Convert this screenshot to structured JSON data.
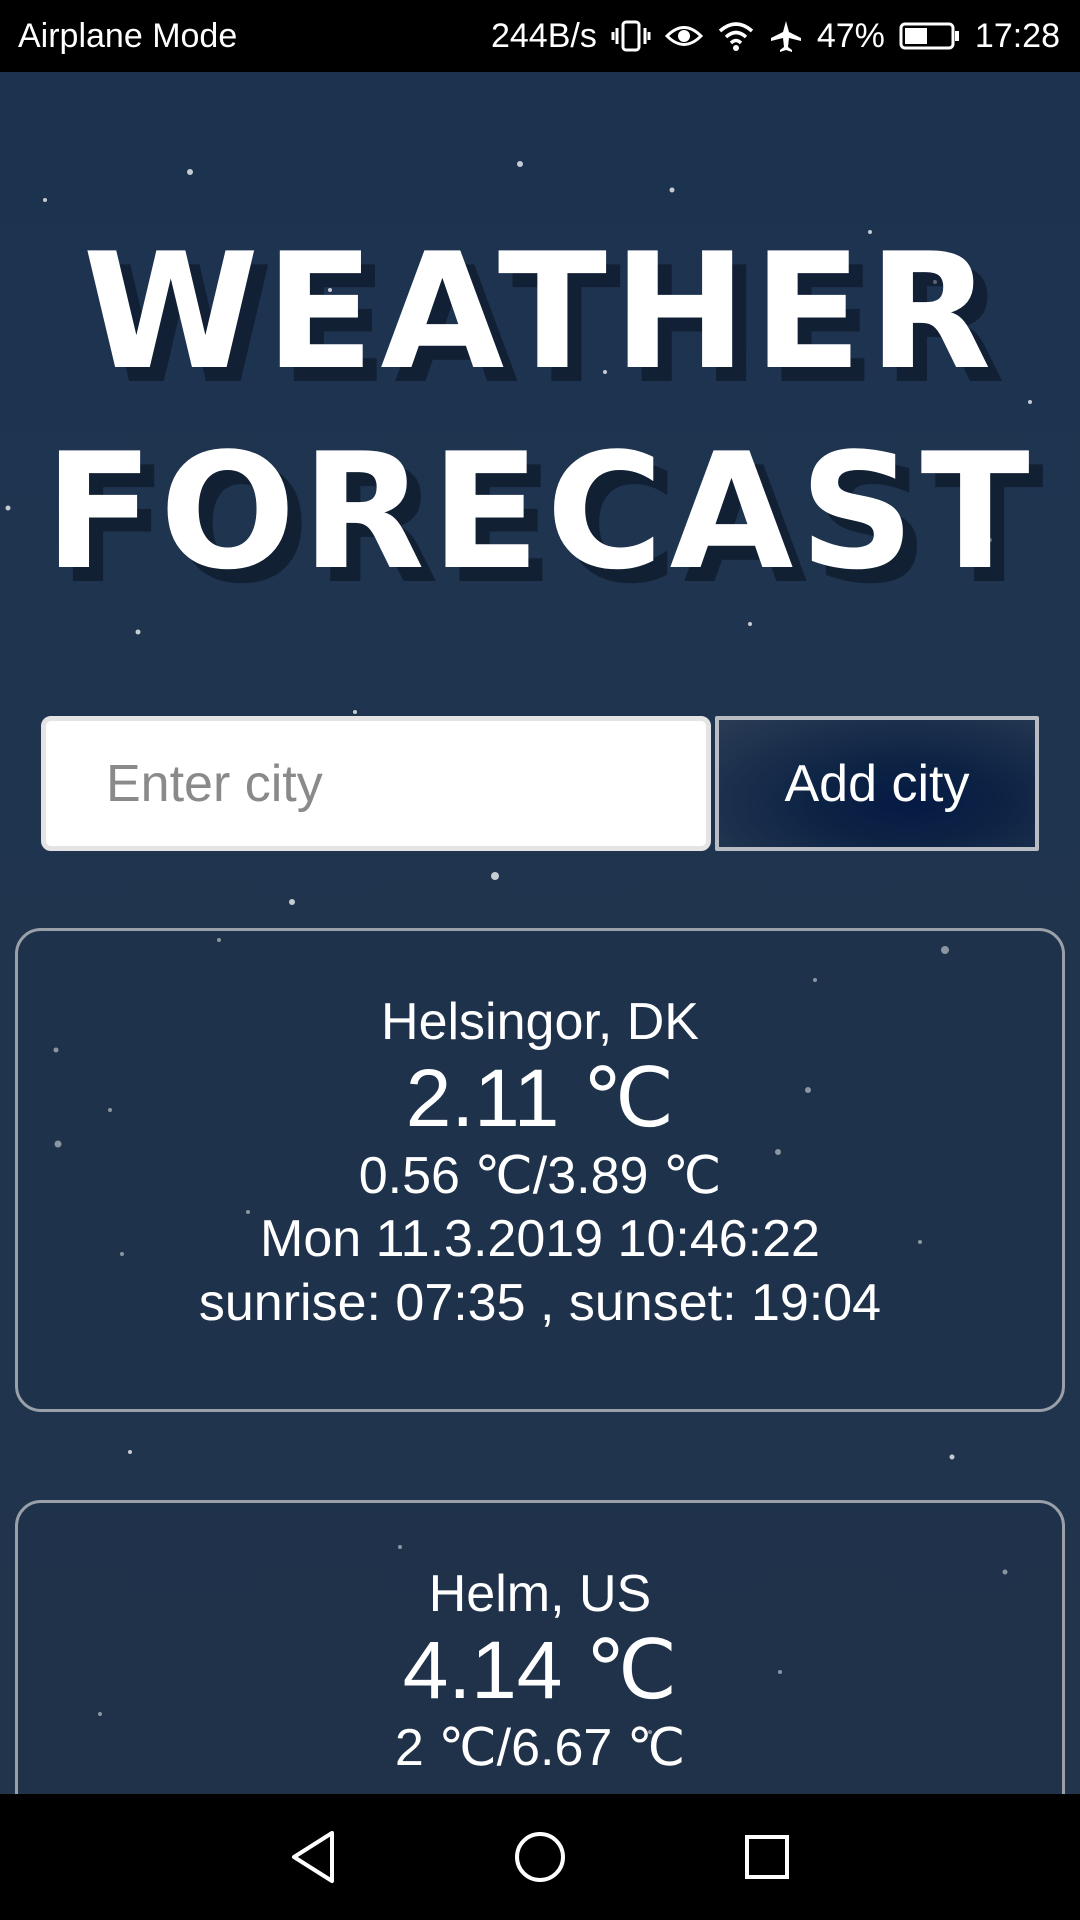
{
  "status_bar": {
    "mode": "Airplane Mode",
    "net_speed": "244B/s",
    "battery": "47%",
    "time": "17:28",
    "icons": [
      "vibrate-icon",
      "eye-icon",
      "wifi-icon",
      "airplane-icon",
      "battery-icon"
    ]
  },
  "app": {
    "title_line1": "WEATHER",
    "title_line2": "FORECAST",
    "input_placeholder": "Enter city",
    "add_button": "Add city"
  },
  "cards": [
    {
      "city": "Helsingor, DK",
      "temp": "2.11 ℃",
      "range": "0.56 ℃/3.89 ℃",
      "date": "Mon 11.3.2019 10:46:22",
      "sun": "sunrise: 07:35 , sunset: 19:04"
    },
    {
      "city": "Helm, US",
      "temp": "4.14 ℃",
      "range": "2 ℃/6.67 ℃"
    }
  ],
  "nav_bar": {
    "icons": [
      "back-icon",
      "home-icon",
      "recents-icon"
    ]
  },
  "colors": {
    "background": "#1e334e",
    "card_border": "#9aa0a8",
    "button_dark": "#0d2344"
  }
}
